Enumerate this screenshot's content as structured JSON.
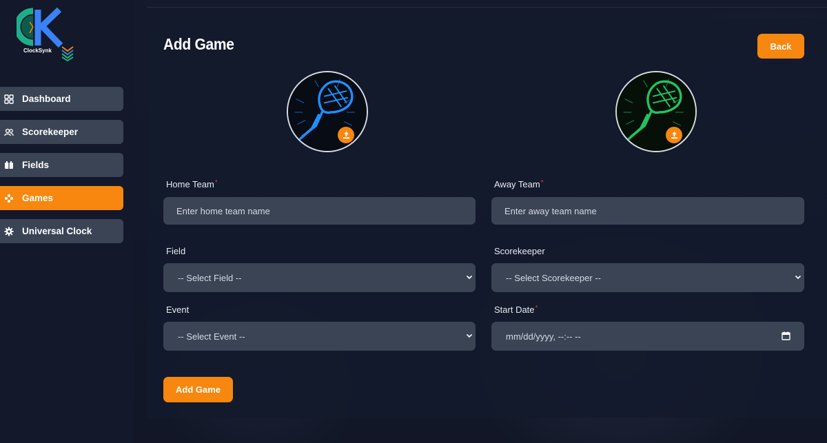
{
  "brand": {
    "logo_text": "ClockSynk"
  },
  "colors": {
    "accent": "#f7870e",
    "nav_bg": "#3a4455",
    "required": "#e03a3a",
    "home_team_glow": "#1e90ff",
    "away_team_glow": "#22c55e"
  },
  "sidebar": {
    "items": [
      {
        "label": "Dashboard",
        "icon": "grid-icon",
        "active": false
      },
      {
        "label": "Scorekeeper",
        "icon": "users-icon",
        "active": false
      },
      {
        "label": "Fields",
        "icon": "field-icon",
        "active": false
      },
      {
        "label": "Games",
        "icon": "gamepad-icon",
        "active": true
      },
      {
        "label": "Universal Clock",
        "icon": "gear-icon",
        "active": false
      }
    ]
  },
  "page": {
    "title": "Add Game",
    "back_label": "Back",
    "submit_label": "Add Game"
  },
  "form": {
    "home_team": {
      "label": "Home Team",
      "required": "*",
      "placeholder": "Enter home team name"
    },
    "away_team": {
      "label": "Away Team",
      "required": "*",
      "placeholder": "Enter away team name"
    },
    "field": {
      "label": "Field",
      "selected": "-- Select Field --"
    },
    "scorekeeper": {
      "label": "Scorekeeper",
      "selected": "-- Select Scorekeeper --"
    },
    "event": {
      "label": "Event",
      "selected": "-- Select Event --"
    },
    "start_date": {
      "label": "Start Date",
      "required": "*",
      "placeholder": "mm/dd/yyyy, --:-- --"
    }
  }
}
